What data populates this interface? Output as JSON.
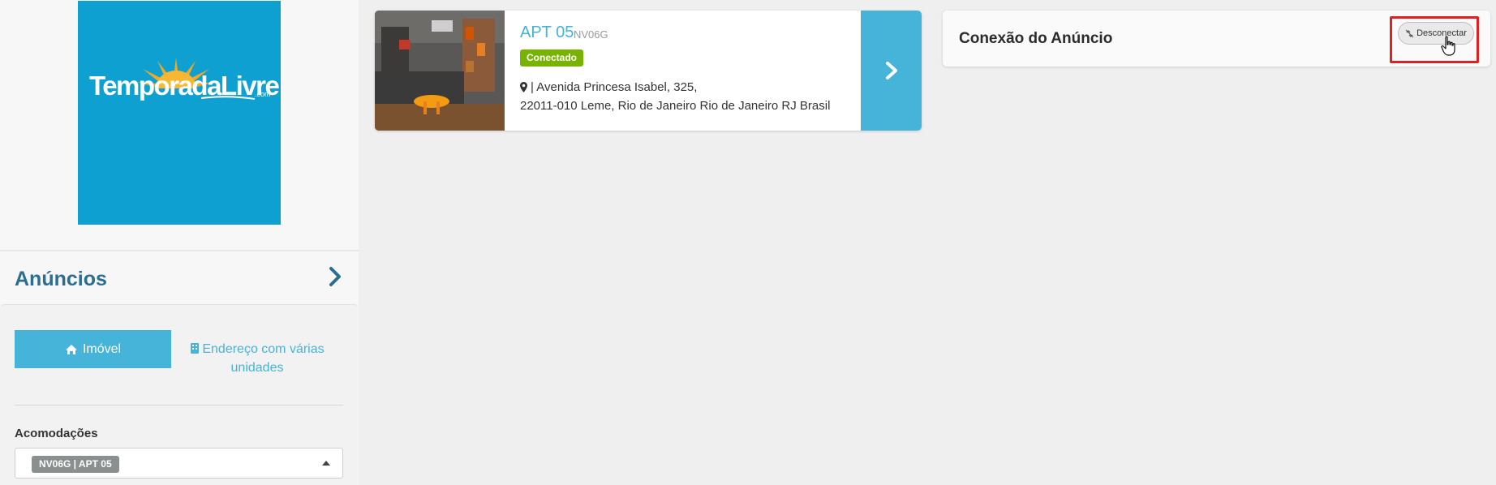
{
  "brand": {
    "logo_text_a": "Temporada",
    "logo_text_b": "Livre",
    "logo_suffix": ".com",
    "logo_bg": "#0fa0d2",
    "sun_color": "#f5a623"
  },
  "sidebar": {
    "section_title": "Anúncios",
    "chevron_icon": "chevron-right-icon",
    "tabs": {
      "imovel_label": "Imóvel",
      "imovel_icon": "home-icon",
      "endereco_label": "Endereço com várias unidades",
      "endereco_icon": "building-icon"
    },
    "acomodacoes_label": "Acomodações",
    "selected_accommodation": "NV06G | APT 05"
  },
  "listing": {
    "title": "APT 05",
    "code": "NV06G",
    "status": "Conectado",
    "status_color": "#77b300",
    "address_line1": "| Avenida Princesa Isabel, 325,",
    "address_line2": "22011-010 Leme, Rio de Janeiro Rio de Janeiro RJ Brasil",
    "pin_icon": "map-marker-icon"
  },
  "connection": {
    "title": "Conexão do Anúncio",
    "disconnect_label": "Desconectar",
    "disconnect_icon": "unlink-icon"
  },
  "colors": {
    "accent": "#45b4d8",
    "heading_blue": "#2c6e91",
    "highlight_red": "#e02020"
  }
}
